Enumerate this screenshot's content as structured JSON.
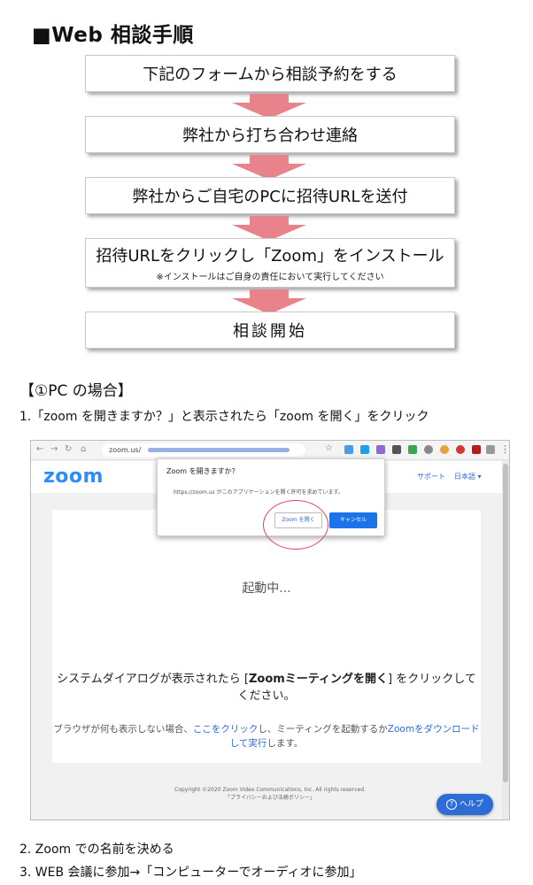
{
  "heading": "■Web 相談手順",
  "steps": [
    {
      "text": "下記のフォームから相談予約をする"
    },
    {
      "text": "弊社から打ち合わせ連絡"
    },
    {
      "text": "弊社からご自宅のPCに招待URLを送付"
    },
    {
      "text": "招待URLをクリックし「Zoom」をインストール",
      "note": "※インストールはご自身の責任において実行してください"
    },
    {
      "text": "相談開始"
    }
  ],
  "arrow_color": "#e8838c",
  "section": {
    "title": "【①PC の場合】",
    "line1": "1.「zoom を開きますか？」と表示されたら「zoom を開く」をクリック",
    "line2": "2. Zoom での名前を決める",
    "line3": "3. WEB 会議に参加→「コンピューターでオーディオに参加」"
  },
  "screenshot": {
    "url": "zoom.us/",
    "logo": "zoom",
    "support": "サポート",
    "language": "日本語 ▾",
    "dialog": {
      "title": "Zoom を開きますか？",
      "message": "https://zoom.us がこのアプリケーションを開く許可を求めています。",
      "open_button": "Zoom を開く",
      "cancel_button": "キャンセル"
    },
    "launching": "起動中...",
    "system_message_prefix": "システムダイアログが表示されたら [",
    "system_message_bold": "Zoomミーティングを開く",
    "system_message_suffix": "] をクリックしてください。",
    "browser_msg_1": "ブラウザが何も表示しない場合、",
    "browser_link_1": "ここをクリック",
    "browser_msg_2": "し、ミーティングを起動するか",
    "browser_link_2": "Zoomをダウンロードして実行",
    "browser_msg_3": "します。",
    "footer_1": "Copyright ©2020 Zoom Video Communications, Inc. All rights reserved.",
    "footer_2": "「プライバシーおよび法務ポリシー」",
    "help_label": "ヘルプ",
    "brand_color": "#2d8cff",
    "highlight_color": "#e0445a"
  }
}
